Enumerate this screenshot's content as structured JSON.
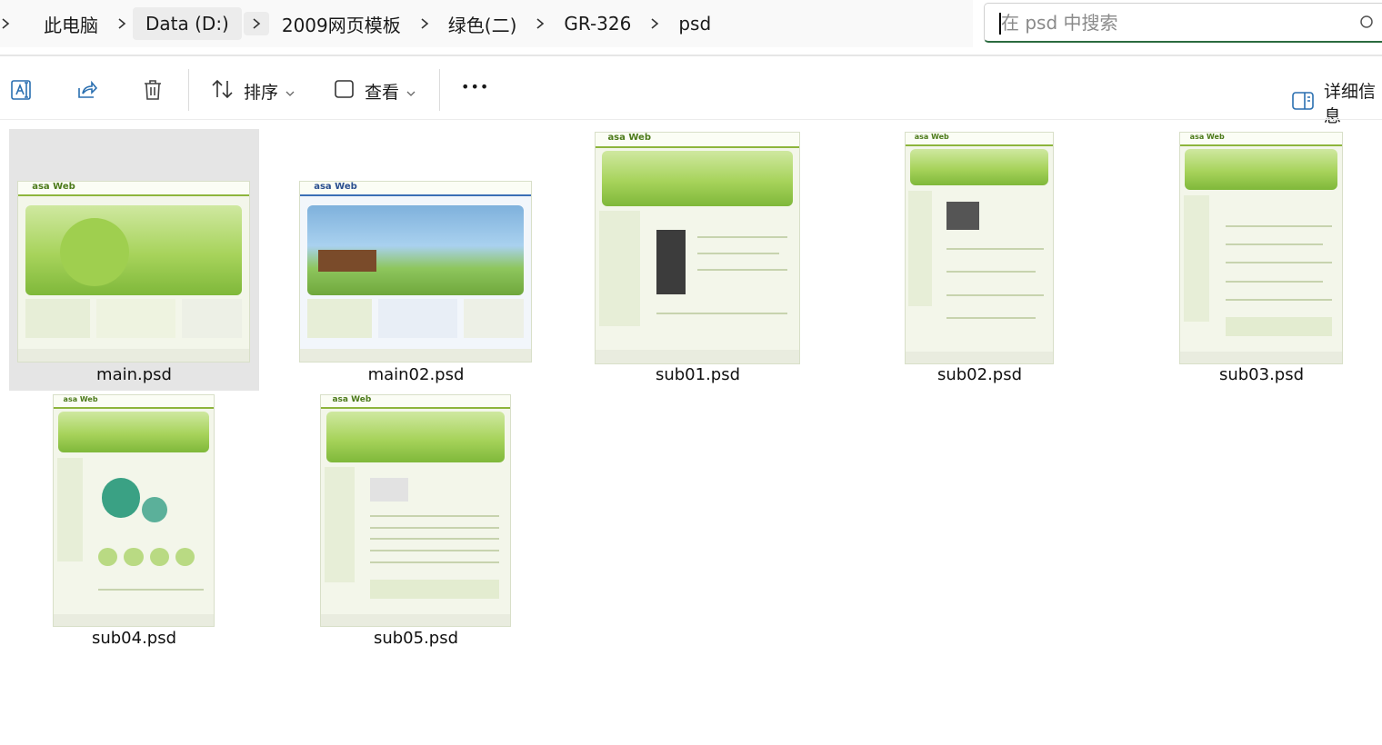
{
  "breadcrumb": {
    "items": [
      "此电脑",
      "Data (D:)",
      "2009网页模板",
      "绿色(二)",
      "GR-326",
      "psd"
    ]
  },
  "search": {
    "placeholder": "在 psd 中搜索"
  },
  "toolbar": {
    "sort_label": "排序",
    "view_label": "查看",
    "more_label": "•••",
    "details_label": "详细信息"
  },
  "icons": {
    "rename": "rename-icon",
    "share": "share-icon",
    "delete": "trash-icon",
    "sort": "sort-arrows-icon",
    "view": "view-square-icon",
    "details": "details-pane-icon",
    "search": "search-icon"
  },
  "colors": {
    "accent": "#2b6b3f",
    "selection": "#e5e5e5",
    "thumb_green": "#8db53c"
  },
  "files": [
    {
      "name": "main.psd"
    },
    {
      "name": "main02.psd"
    },
    {
      "name": "sub01.psd"
    },
    {
      "name": "sub02.psd"
    },
    {
      "name": "sub03.psd"
    },
    {
      "name": "sub04.psd"
    },
    {
      "name": "sub05.psd"
    }
  ]
}
